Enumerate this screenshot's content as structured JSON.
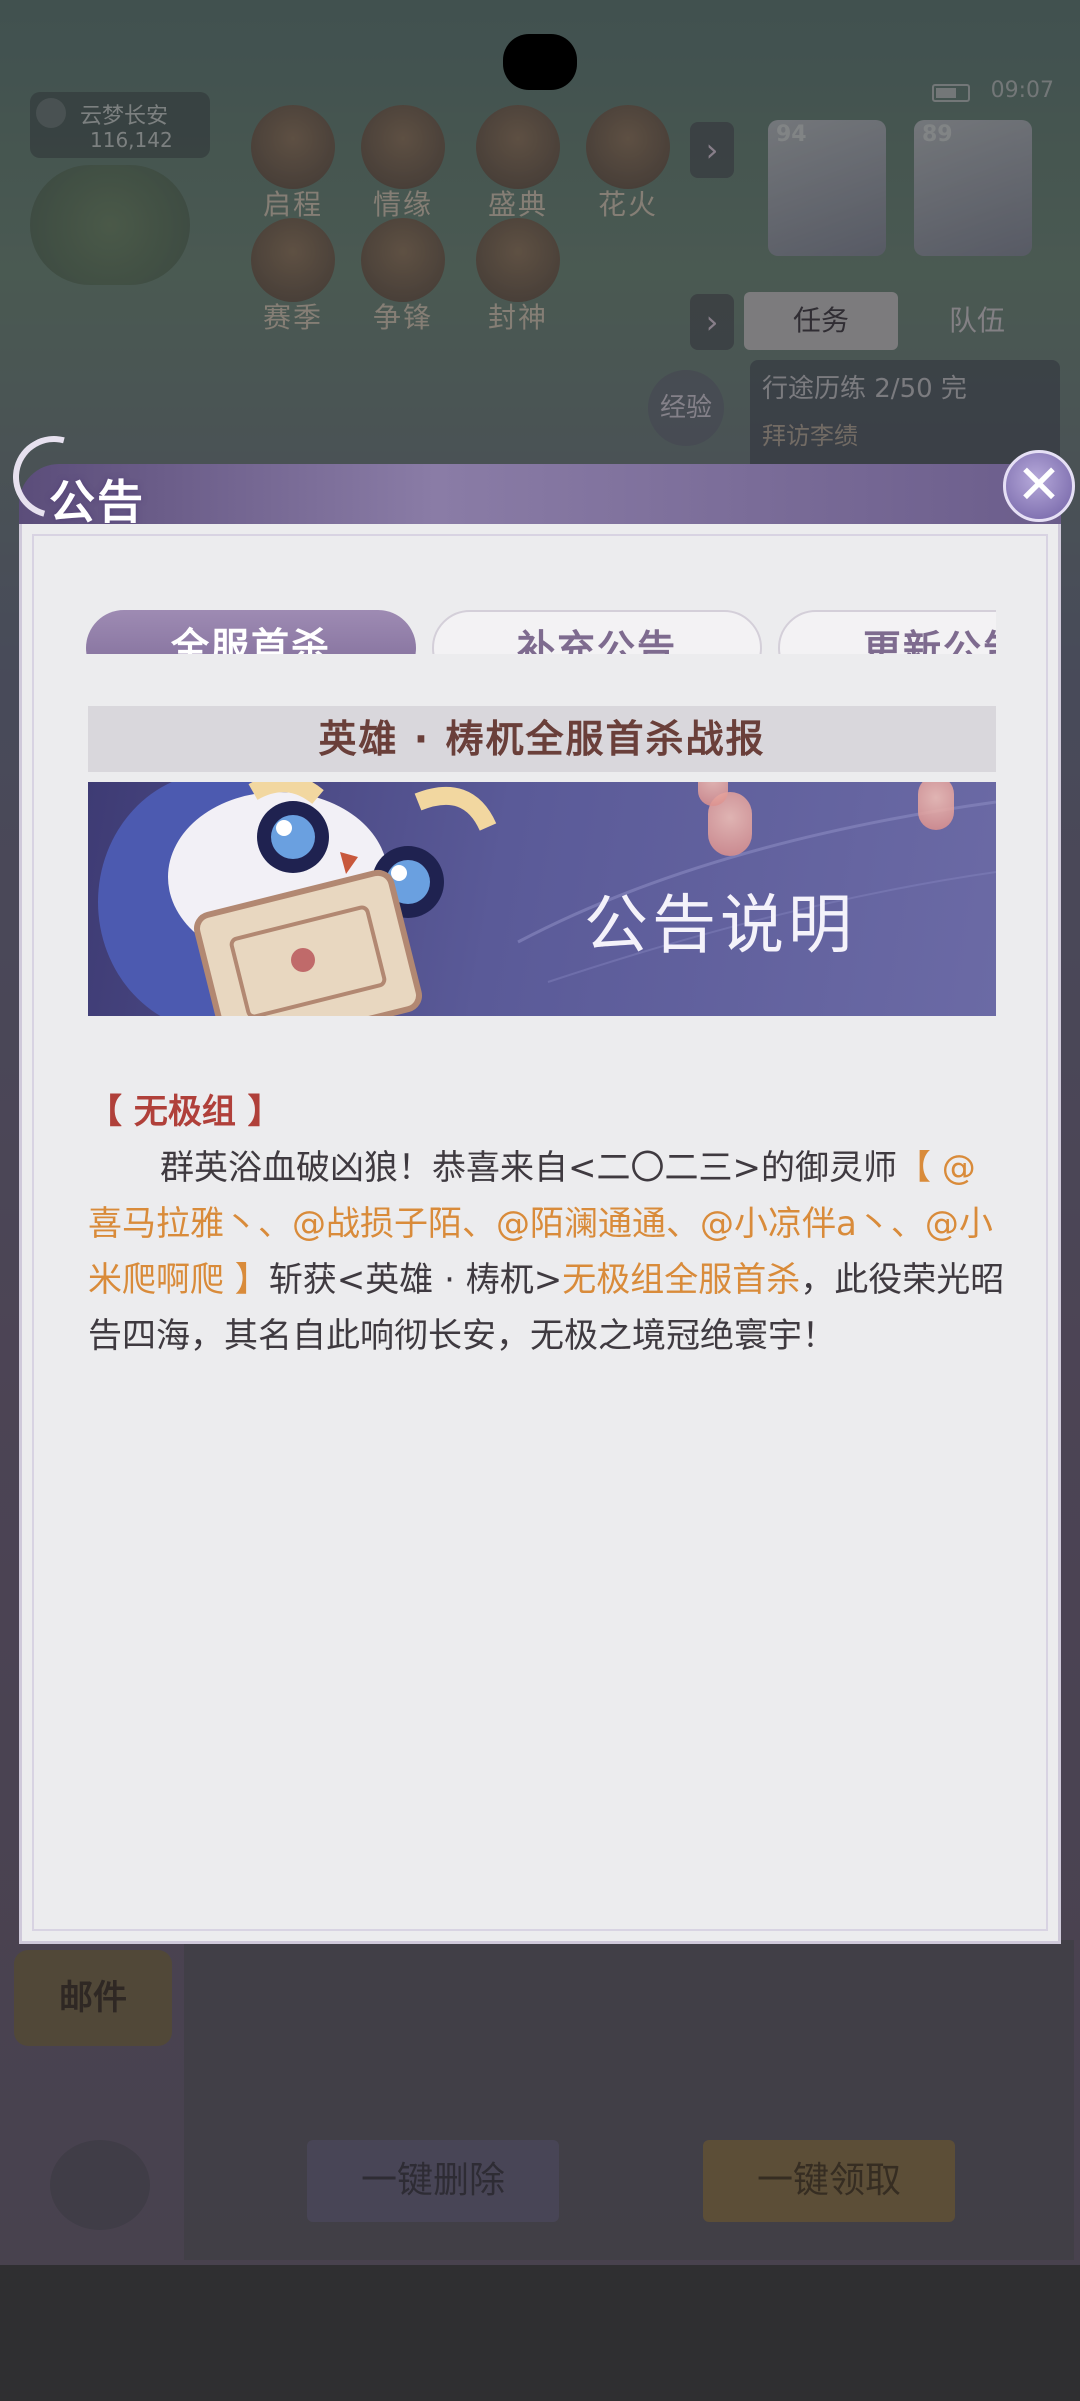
{
  "background": {
    "location_name": "云梦长安",
    "location_coords": "116,142",
    "status_time": "09:07",
    "top_icons": [
      {
        "label": "启程",
        "icon": "scroll-icon"
      },
      {
        "label": "情缘",
        "icon": "heart-scroll-icon"
      },
      {
        "label": "盛典",
        "icon": "pavilion-icon"
      },
      {
        "label": "花火",
        "icon": "firework-icon"
      },
      {
        "label": "赛季",
        "icon": "season-icon"
      },
      {
        "label": "争锋",
        "icon": "banner-icon"
      },
      {
        "label": "封神",
        "icon": "planet-icon"
      }
    ],
    "portraits": [
      {
        "level": "94"
      },
      {
        "level": "89"
      }
    ],
    "task_tabs": [
      "任务",
      "队伍"
    ],
    "exp_label": "经验",
    "task_line1": "行途历练 2/50",
    "task_status": "完",
    "task_line2": "拜访李绩",
    "mail_tab": "邮件",
    "delete_all": "一键删除",
    "claim_all": "一键领取"
  },
  "modal": {
    "title": "公告",
    "close_icon": "close-icon",
    "tabs": [
      {
        "label": "全服首杀",
        "active": true
      },
      {
        "label": "补充公告",
        "active": false
      },
      {
        "label": "更新公告",
        "active": false
      }
    ],
    "section_title": "英雄 · 梼杌全服首杀战报",
    "banner_text": "公告说明",
    "group": "【 无极组 】",
    "para": {
      "p1": "群英浴血破凶狼！恭喜来自<二〇二三>的御灵师",
      "h1": "【 @喜马拉雅丶、@战损子陌、@陌澜通通、@小凉伴a丶、@小米爬啊爬 】",
      "p2": "斩获<英雄 · 梼杌>",
      "h2": "无极组全服首杀",
      "p3": "，此役荣光昭告四海，其名自此响彻长安，无极之境冠绝寰宇！"
    }
  },
  "colors": {
    "accent_purple": "#8a779f",
    "title_red": "#6a3f3a",
    "group_red": "#b0403a",
    "highlight_orange": "#d98b3a"
  }
}
